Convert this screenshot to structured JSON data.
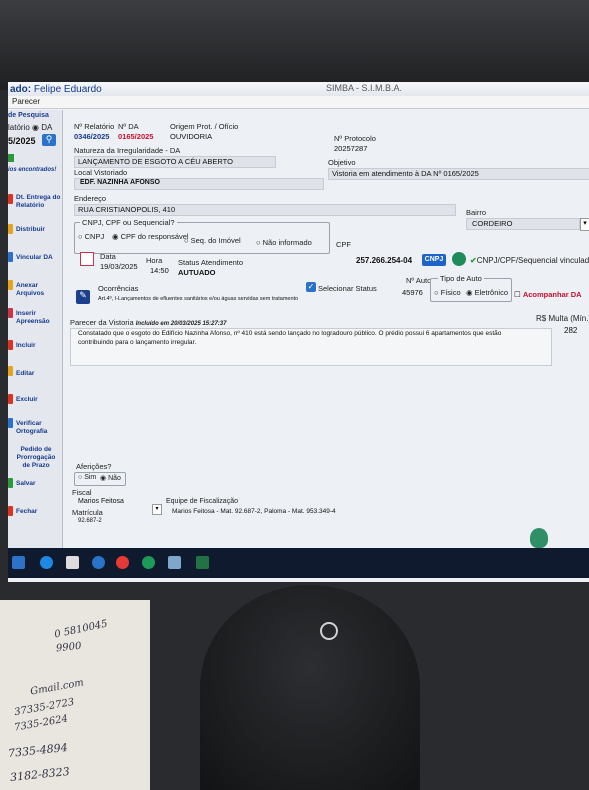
{
  "window": {
    "user_prefix": "ado:",
    "user_name": "Felipe Eduardo",
    "app_title": "SIMBA - S.I.M.B.A."
  },
  "menu": {
    "parecer": "Parecer"
  },
  "sidebar": {
    "search_label": "de Pesquisa",
    "relatorio_label": "latório",
    "da_label": "DA",
    "date_value": "5/2025",
    "found_label": "ios encontrados!",
    "items": [
      "Dt. Entrega do Relatório",
      "Distribuir",
      "Vincular DA",
      "Anexar Arquivos",
      "Inserir Apreensão",
      "Incluir",
      "Editar",
      "Excluir",
      "Verificar Ortografia",
      "Pedido de Prorrogação de Prazo",
      "Salvar",
      "Fechar"
    ]
  },
  "form": {
    "n_relatorio_label": "Nº Relatório",
    "n_relatorio_value": "0346/2025",
    "n_da_label": "Nº DA",
    "n_da_value": "0165/2025",
    "origem_label": "Origem Prot. / Ofício",
    "origem_value": "OUVIDORIA",
    "protocolo_label": "Nº Protocolo",
    "protocolo_value": "20257287",
    "natureza_label": "Natureza da Irregularidade - DA",
    "natureza_value": "LANÇAMENTO DE ESGOTO A CÉU ABERTO",
    "objetivo_label": "Objetivo",
    "objetivo_value": "Vistoria em atendimento à DA Nº 0165/2025",
    "local_label": "Local Vistoriado",
    "local_value": "EDF. NAZINHA AFONSO",
    "endereco_label": "Endereço",
    "endereco_value": "RUA CRISTIANOPOLIS, 410",
    "bairro_label": "Bairro",
    "bairro_value": "CORDEIRO",
    "cnpj_group_label": "CNPJ, CPF ou Sequencial?",
    "radio_cnpj": "CNPJ",
    "radio_cpf": "CPF do responsável",
    "radio_seq": "Seq. do Imóvel",
    "radio_nao": "Não informado",
    "cpf_label": "CPF",
    "cpf_value": "257.266.254-04",
    "cnpj_button": "CNPJ",
    "vinculado_text": "CNPJ/CPF/Sequencial vinculado",
    "data_label": "Data",
    "data_value": "19/03/2025",
    "hora_label": "Hora",
    "hora_value": "14:50",
    "status_label": "Status Atendimento",
    "status_value": "AUTUADO",
    "n_auto_label": "Nº Auto",
    "n_auto_value": "45976",
    "selecionar_status": "Selecionar Status",
    "tipo_auto_label": "Tipo de Auto",
    "radio_fisico": "Físico",
    "radio_eletronico": "Eletrônico",
    "acompanhar_da": "Acompanhar DA",
    "ocorrencias_label": "Ocorrências",
    "ocorrencia_text": "Art.4º, I-Lançamentos de efluentes sanitários e/ou águas servidas sem tratamento",
    "multa_label": "R$ Multa (Mín.)",
    "multa_value": "282",
    "parecer_label": "Parecer da Vistoria",
    "parecer_included": "Incluído em 20/03/2025 15:27:37",
    "parecer_text_1": "Constatado que o esgoto do Edifício Nazinha Afonso, nº 410 está sendo lançado no logradouro público. O prédio possui 6 apartamentos que estão",
    "parecer_text_2": "contribuindo para o lançamento irregular.",
    "afericoes_label": "Aferições?",
    "radio_sim": "Sim",
    "radio_nao2": "Não",
    "fiscal_label": "Fiscal",
    "fiscal_value": "Marios Feitosa",
    "matricula_label": "Matrícula",
    "matricula_value": "92.687-2",
    "equipe_label": "Equipe de Fiscalização",
    "equipe_value": "Marios Feitosa - Mat. 92.687-2, Paloma - Mat. 953.349-4"
  },
  "notes": {
    "line1": "0 5810045",
    "line2": "9900",
    "line3": "Gmail.com",
    "line4": "37335-2723",
    "line5": "7335-2624",
    "line6": "7335-4894",
    "line7": "3182-8323"
  },
  "colors": {
    "accent_blue": "#173a8c",
    "alert_red": "#c8102e",
    "cnpj_button": "#1e63c9",
    "round_button": "#1f8a5a"
  }
}
